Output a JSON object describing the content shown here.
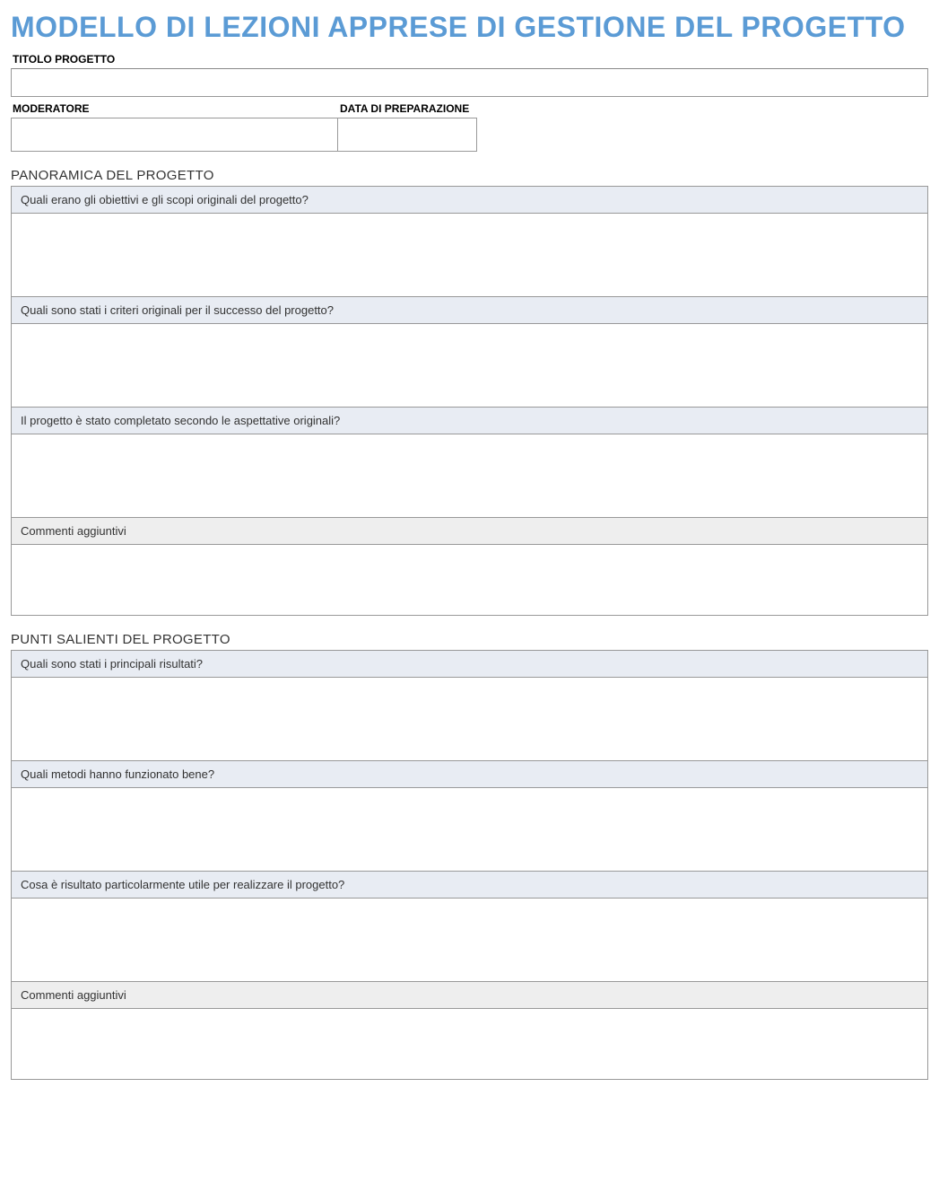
{
  "title": "MODELLO DI LEZIONI APPRESE DI GESTIONE DEL PROGETTO",
  "fields": {
    "project_title_label": "TITOLO PROGETTO",
    "project_title_value": "",
    "moderator_label": "MODERATORE",
    "moderator_value": "",
    "date_label": "DATA DI PREPARAZIONE",
    "date_value": ""
  },
  "sections": [
    {
      "title": "PANORAMICA DEL PROGETTO",
      "questions": [
        {
          "label": "Quali erano gli obiettivi e gli scopi originali del progetto?",
          "style": "blue",
          "value": ""
        },
        {
          "label": "Quali sono stati i criteri originali per il successo del progetto?",
          "style": "blue",
          "value": ""
        },
        {
          "label": "Il progetto è stato completato secondo le aspettative originali?",
          "style": "blue",
          "value": ""
        },
        {
          "label": "Commenti aggiuntivi",
          "style": "gray",
          "value": ""
        }
      ]
    },
    {
      "title": "PUNTI SALIENTI DEL PROGETTO",
      "questions": [
        {
          "label": "Quali sono stati i principali risultati?",
          "style": "blue",
          "value": ""
        },
        {
          "label": "Quali metodi hanno funzionato bene?",
          "style": "blue",
          "value": ""
        },
        {
          "label": "Cosa è risultato particolarmente utile per realizzare il progetto?",
          "style": "blue",
          "value": ""
        },
        {
          "label": "Commenti aggiuntivi",
          "style": "gray",
          "value": ""
        }
      ]
    }
  ]
}
